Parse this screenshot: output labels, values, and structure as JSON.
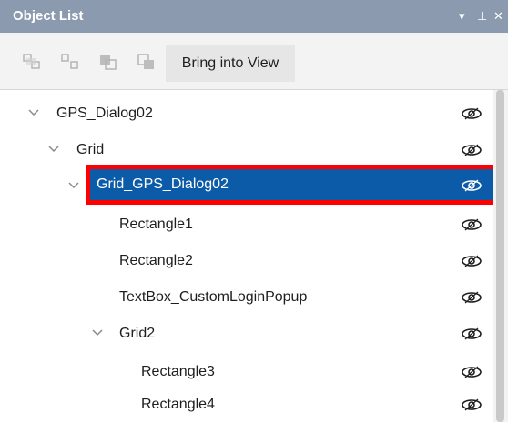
{
  "panel": {
    "title": "Object List",
    "controls": {
      "dropdown": "▾",
      "pin": "⊥",
      "close": "✕"
    }
  },
  "toolbar": {
    "icons": [
      "group-icon",
      "ungroup-icon",
      "bring-forward-icon",
      "send-backward-icon"
    ],
    "bring_into_view_label": "Bring into View"
  },
  "tree": {
    "items": [
      {
        "label": "GPS_Dialog02",
        "expanded": true,
        "level": 0,
        "visible": true
      },
      {
        "label": "Grid",
        "expanded": true,
        "level": 1,
        "visible": true
      },
      {
        "label": "Grid_GPS_Dialog02",
        "expanded": true,
        "level": 2,
        "visible": true,
        "selected": true
      },
      {
        "label": "Rectangle1",
        "level": 3,
        "visible": true
      },
      {
        "label": "Rectangle2",
        "level": 3,
        "visible": true
      },
      {
        "label": "TextBox_CustomLoginPopup",
        "level": 3,
        "visible": true
      },
      {
        "label": "Grid2",
        "expanded": true,
        "level": 3,
        "visible": true
      },
      {
        "label": "Rectangle3",
        "level": 4,
        "visible": true
      },
      {
        "label": "Rectangle4",
        "level": 4,
        "visible": true
      }
    ]
  },
  "colors": {
    "titlebar": "#8b9aae",
    "selection": "#0c5ba8",
    "highlight_border": "#ff0000"
  }
}
